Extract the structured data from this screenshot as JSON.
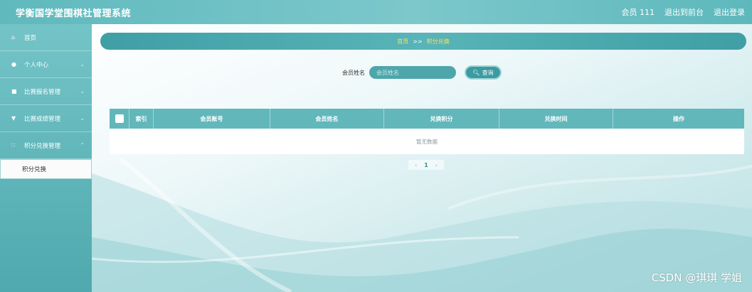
{
  "header": {
    "title": "学衡国学堂围棋社管理系统",
    "user_label": "会员 111",
    "to_front": "退出到前台",
    "logout": "退出登录"
  },
  "sidebar": {
    "items": [
      {
        "label": "首页",
        "icon": "home-icon"
      },
      {
        "label": "个人中心",
        "icon": "user-icon"
      },
      {
        "label": "比赛报名管理",
        "icon": "register-icon"
      },
      {
        "label": "比赛成绩管理",
        "icon": "trophy-icon"
      },
      {
        "label": "积分兑换管理",
        "icon": "grid-icon"
      }
    ],
    "sub_item": "积分兑换"
  },
  "breadcrumb": {
    "home": "首页",
    "separator": ">>",
    "current": "积分兑换"
  },
  "search": {
    "label": "会员姓名",
    "placeholder": "会员姓名",
    "button": "查询"
  },
  "table": {
    "columns": [
      "索引",
      "会员账号",
      "会员姓名",
      "兑换积分",
      "兑换时间",
      "操作"
    ],
    "empty_text": "暂无数据"
  },
  "pagination": {
    "prev": "‹",
    "current": "1",
    "next": "›"
  },
  "watermark": "CSDN @琪琪 学姐",
  "colors": {
    "accent": "#62b7bb",
    "breadcrumb_text": "#ffe15a"
  }
}
